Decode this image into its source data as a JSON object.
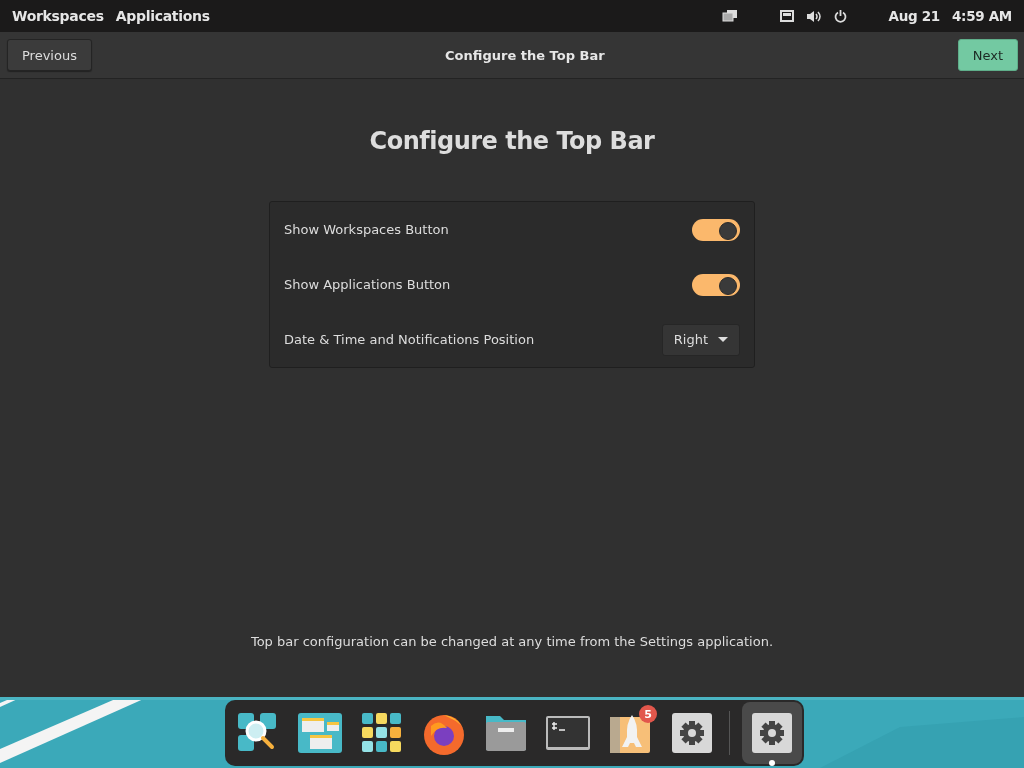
{
  "top_bar": {
    "workspaces": "Workspaces",
    "applications": "Applications",
    "date": "Aug 21",
    "time": "4:59 AM"
  },
  "header": {
    "previous": "Previous",
    "title": "Configure the Top Bar",
    "next": "Next"
  },
  "heading": "Configure the Top Bar",
  "settings": [
    {
      "kind": "switch",
      "label": "Show Workspaces Button",
      "on": true
    },
    {
      "kind": "switch",
      "label": "Show Applications Button",
      "on": true
    },
    {
      "kind": "dropdown",
      "label": "Date & Time and Notifications Position",
      "value": "Right"
    }
  ],
  "footnote": "Top bar configuration can be changed at any time from the Settings application.",
  "dock": [
    {
      "kind": "search",
      "selected": false
    },
    {
      "kind": "windows",
      "selected": false
    },
    {
      "kind": "grid",
      "selected": false
    },
    {
      "kind": "browser",
      "selected": false
    },
    {
      "kind": "folder",
      "selected": false
    },
    {
      "kind": "terminal",
      "selected": false
    },
    {
      "kind": "rocket",
      "selected": false,
      "badge": "5"
    },
    {
      "kind": "gear",
      "selected": false
    },
    {
      "kind": "gear",
      "selected": true
    }
  ]
}
